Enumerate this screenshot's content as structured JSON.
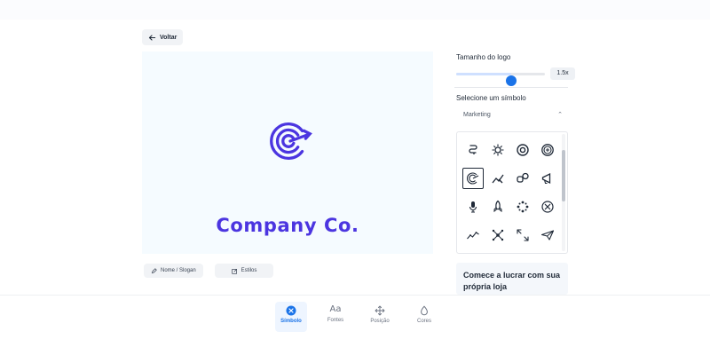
{
  "header": {
    "back_label": "Voltar"
  },
  "canvas": {
    "company_name": "Company Co.",
    "logo_icon": "target-arrow-icon",
    "brand_color": "#4b35e0",
    "background_color": "#f5fbff"
  },
  "editor_pills": {
    "name_label": "Nome / Slogan",
    "style_label": "Estilos"
  },
  "sidebar": {
    "size_label": "Tamanho do logo",
    "size_value": "1.5x",
    "size_fraction": 0.62,
    "symbol_label": "Selecione um símbolo",
    "category_value": "Marketing",
    "symbols": [
      {
        "icon": "squiggle-icon",
        "selected": false
      },
      {
        "icon": "sun-gear-icon",
        "selected": false
      },
      {
        "icon": "donut-circle-icon",
        "selected": false
      },
      {
        "icon": "badge-circle-icon",
        "selected": false
      },
      {
        "icon": "target-arrow-icon",
        "selected": true
      },
      {
        "icon": "cursor-chart-icon",
        "selected": false
      },
      {
        "icon": "linked-shapes-icon",
        "selected": false
      },
      {
        "icon": "megaphone-icon",
        "selected": false
      },
      {
        "icon": "microphone-icon",
        "selected": false
      },
      {
        "icon": "rocket-icon",
        "selected": false
      },
      {
        "icon": "dots-burst-icon",
        "selected": false
      },
      {
        "icon": "circle-x-icon",
        "selected": false
      },
      {
        "icon": "trend-line-icon",
        "selected": false
      },
      {
        "icon": "network-nodes-icon",
        "selected": false
      },
      {
        "icon": "expand-arrows-icon",
        "selected": false
      },
      {
        "icon": "paper-plane-icon",
        "selected": false
      }
    ],
    "promo_text": "Comece a lucrar com sua própria loja"
  },
  "bottom_nav": {
    "items": [
      {
        "label": "Símbolo",
        "icon": "symbol-icon",
        "active": true
      },
      {
        "label": "Fontes",
        "icon": "font-aa-icon",
        "active": false
      },
      {
        "label": "Posição",
        "icon": "move-arrows-icon",
        "active": false
      },
      {
        "label": "Cores",
        "icon": "droplet-icon",
        "active": false
      }
    ]
  },
  "colors": {
    "accent": "#1a73e8"
  }
}
